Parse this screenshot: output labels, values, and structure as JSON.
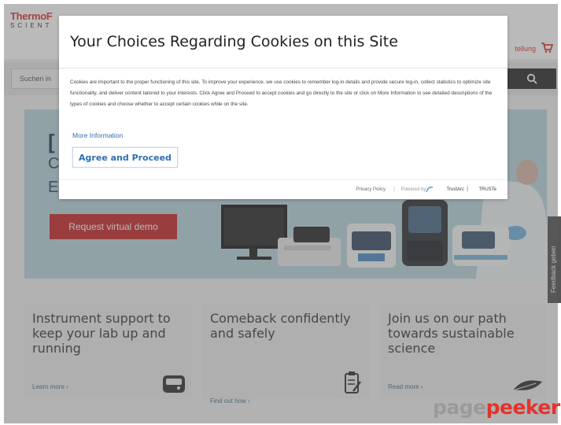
{
  "site": {
    "logo_main": "ThermoF",
    "logo_sub": "SCIENT",
    "order_link": "tellung",
    "cart_icon": "cart-icon",
    "search_placeholder": "Suchen in",
    "search_icon": "search-icon"
  },
  "hero": {
    "bracket": "[",
    "line1": "C",
    "line2": "E",
    "demo_button": "Request virtual demo"
  },
  "cards": [
    {
      "title": "Instrument support to keep your lab up and running",
      "link": "Learn more ›",
      "icon": "device-icon"
    },
    {
      "title": "Comeback confidently and safely",
      "link": "Find out how ›",
      "icon": "clipboard-icon"
    },
    {
      "title": "Join us on our path towards sustainable science",
      "link": "Read more ›",
      "icon": "leaf-icon"
    }
  ],
  "feedback": "Feedback geben",
  "modal": {
    "title": "Your Choices Regarding Cookies on this Site",
    "body": "Cookies are important to the proper functioning of this site. To improve your experience, we use cookies to remember log-in details and provide secure log-in, collect statistics to optimize site functionality, and deliver content tailored to your interests. Click Agree and Proceed to accept cookies and go directly to the site or click on More Information to see detailed descriptions of the types of cookies and choose whether to accept certain cookies while on the site.",
    "more_info": "More Information",
    "agree_button": "Agree and Proceed",
    "footer": {
      "privacy": "Privacy Policy",
      "separator": "|",
      "powered_by": "Powered by:",
      "trustarc": "TrustArc",
      "bar": "|",
      "truste": "TRUSTe"
    }
  },
  "watermark": {
    "part1": "page",
    "part2": "peeker"
  },
  "colors": {
    "brand_red": "#e0322e",
    "link_blue": "#2f6fb3",
    "hero_bg": "#b8d6de",
    "overlay": "rgba(90,90,90,0.42)"
  }
}
